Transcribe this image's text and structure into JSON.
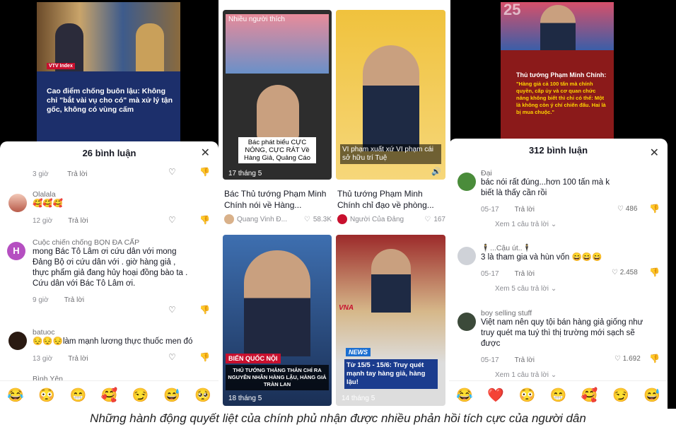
{
  "news_thumb": {
    "headline": "Cao điểm chống buôn lậu: Không chỉ \"bắt vài vụ cho có\" mà xử lý tận gốc, không có vùng cấm",
    "logo": "VTV Index"
  },
  "left_panel": {
    "title": "26 bình luận",
    "comments": [
      {
        "user": "",
        "text": "",
        "time": "3 giờ",
        "reply": "Trả lời"
      },
      {
        "user": "Olalala",
        "text": "🥰🥰🥰",
        "time": "12 giờ",
        "reply": "Trả lời"
      },
      {
        "user": "Cuộc chiến chống BỌN ĐA CẤP",
        "text": "mong Bác Tô Lâm ơi cứu dân với mong Đảng Bộ ơi cứu dân với . giờ hàng giả , thực phẩm giả đang hủy hoại đồng bào ta . Cứu dân với Bác Tô Lâm ơi.",
        "time": "9 giờ",
        "reply": "Trả lời",
        "avatar_letter": "H"
      },
      {
        "user": "batuoc",
        "text": "😔😔😔làm mạnh lương thực thuốc men đó",
        "time": "13 giờ",
        "reply": "Trả lời"
      },
      {
        "user": "Bình Yên",
        "text": "",
        "time": "",
        "reply": ""
      }
    ]
  },
  "video_grid": {
    "tag_top": "Nhiều người thích",
    "cards": [
      {
        "overlay": "Bác phát biểu CỰC NÓNG, CỰC RÁT Về Hàng Giả, Quảng Cáo",
        "date": "17 tháng 5",
        "title": "Bác Thủ tướng Phạm Minh Chính nói về Hàng...",
        "author": "Quang Vinh Đ...",
        "likes": "58.3K"
      },
      {
        "overlay": "VI phạm xuất xứ VI phạm cái sở hữu trí Tuệ",
        "date": "",
        "title": "Thủ tướng Phạm Minh Chính chỉ đạo về phòng...",
        "author": "Người Của Đảng",
        "likes": "167"
      },
      {
        "overlay": "THỦ TƯỚNG THẲNG THẮN CHỈ RA NGUYÊN NHÂN HÀNG LẬU, HÀNG GIẢ TRÀN LAN",
        "banner": "BIẾN QUỐC NỘI",
        "date": "18 tháng 5"
      },
      {
        "overlay": "Từ 15/5 - 15/6: Truy quét mạnh tay hàng giả, hàng lậu!",
        "banner": "NEWS",
        "logo": "VNA",
        "date": "14 tháng 5"
      }
    ]
  },
  "right_thumb": {
    "heading": "Thủ tướng Phạm Minh Chính:",
    "quote": "\"Hàng giả cả 100 tấn mà chính quyền, cấp ủy và cơ quan chức năng không biết thì chỉ có thể: Một là không còn ý chí chiến đấu. Hai là bị mua chuộc.\"",
    "number": "25"
  },
  "right_panel": {
    "title": "312 bình luận",
    "comments": [
      {
        "user": "Đại",
        "text": "bác nói rất đúng...hơn 100 tấn mà k biết là thấy cần rồi",
        "time": "05-17",
        "reply": "Trả lời",
        "likes": "486",
        "more": "Xem 1 câu trả lời"
      },
      {
        "user": "🕴...Cậu út..🕴",
        "text": "3 là tham gia và hùn vốn 😄😄😄",
        "time": "05-17",
        "reply": "Trả lời",
        "likes": "2.458",
        "more": "Xem 5 câu trả lời"
      },
      {
        "user": "boy selling stuff",
        "text": "Việt nam nên quy tội bán hàng giả giống như truy quét ma tuý thì thị trường mới sạch sẽ được",
        "time": "05-17",
        "reply": "Trả lời",
        "likes": "1.692",
        "more": "Xem 1 câu trả lời"
      }
    ]
  },
  "emoji_left": [
    "😂",
    "😳",
    "😁",
    "🥰",
    "😏",
    "😅",
    "🥺"
  ],
  "emoji_right": [
    "😂",
    "❤️",
    "😳",
    "😁",
    "🥰",
    "😏",
    "😅"
  ],
  "caption": "Những hành động quyết liệt của chính phủ nhận được nhiều phản hồi tích cực của người dân",
  "colors": {
    "accent_red": "#c8102e",
    "news_blue": "#1b3c8e",
    "tiktok_text": "#161823"
  }
}
